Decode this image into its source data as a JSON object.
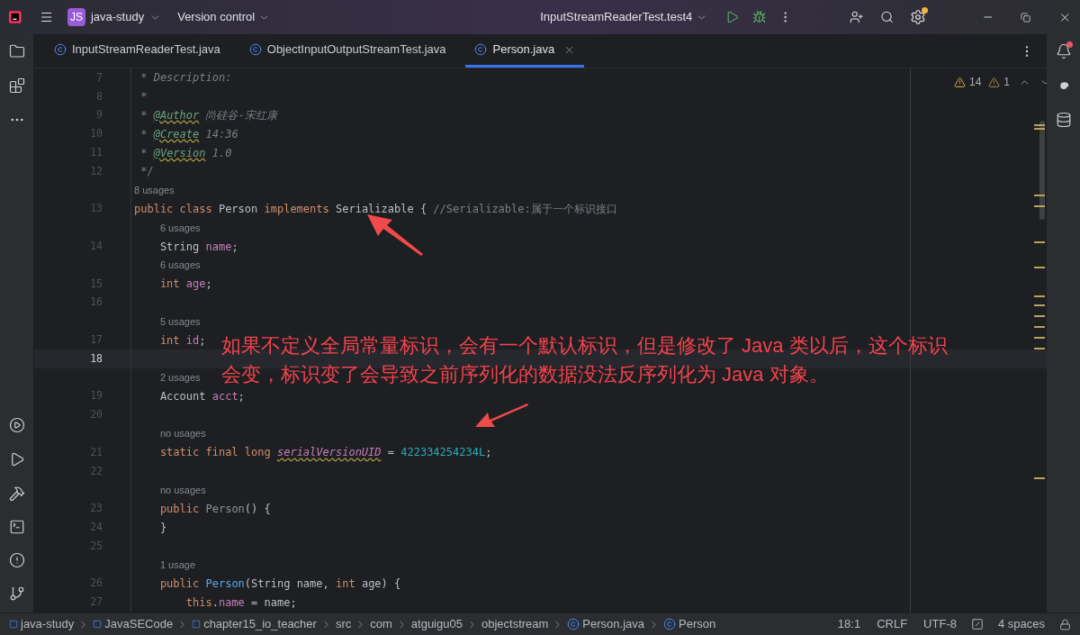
{
  "title_bar": {
    "project": {
      "badge": "JS",
      "name": "java-study"
    },
    "vcs": "Version control",
    "run_config": "InputStreamReaderTest.test4",
    "settings_update": true
  },
  "tabs": [
    {
      "label": "InputStreamReaderTest.java",
      "selected": false,
      "closable": false
    },
    {
      "label": "ObjectInputOutputStreamTest.java",
      "selected": false,
      "closable": false
    },
    {
      "label": "Person.java",
      "selected": true,
      "closable": true
    }
  ],
  "inspections": {
    "warnings": "14",
    "weak_warnings": "1"
  },
  "notifications": {
    "unread": true
  },
  "code": [
    {
      "number": "7",
      "tokens": [
        {
          "text": " * Description:",
          "kind": "doc"
        }
      ]
    },
    {
      "number": "8",
      "tokens": [
        {
          "text": " *",
          "kind": "doc"
        }
      ]
    },
    {
      "number": "9",
      "tokens": [
        {
          "text": " * ",
          "kind": "doc"
        },
        {
          "text": "@Author",
          "kind": "doc-tag"
        },
        {
          "text": " 尚硅谷-宋红康",
          "kind": "doc"
        }
      ]
    },
    {
      "number": "10",
      "tokens": [
        {
          "text": " * ",
          "kind": "doc"
        },
        {
          "text": "@Create",
          "kind": "doc-tag"
        },
        {
          "text": " 14:36",
          "kind": "doc"
        }
      ]
    },
    {
      "number": "11",
      "tokens": [
        {
          "text": " * ",
          "kind": "doc"
        },
        {
          "text": "@Version",
          "kind": "doc-tag"
        },
        {
          "text": " 1.0",
          "kind": "doc"
        }
      ]
    },
    {
      "number": "12",
      "tokens": [
        {
          "text": " */",
          "kind": "doc"
        }
      ]
    },
    {
      "number": "13",
      "usages": "8 usages",
      "tokens": [
        {
          "text": "public class ",
          "kind": "keyword"
        },
        {
          "text": "Person ",
          "kind": "plain"
        },
        {
          "text": "implements ",
          "kind": "keyword"
        },
        {
          "text": "Serializable { ",
          "kind": "plain"
        },
        {
          "text": "//Serializable:属于一个标识接口",
          "kind": "comment"
        }
      ]
    },
    {
      "number": "14",
      "usages": "6 usages",
      "tokens": [
        {
          "text": "    String ",
          "kind": "plain"
        },
        {
          "text": "name",
          "kind": "field"
        },
        {
          "text": ";",
          "kind": "plain"
        }
      ]
    },
    {
      "number": "15",
      "usages": "6 usages",
      "tokens": [
        {
          "text": "    int ",
          "kind": "keyword"
        },
        {
          "text": "age",
          "kind": "field"
        },
        {
          "text": ";",
          "kind": "plain"
        }
      ]
    },
    {
      "number": "16"
    },
    {
      "number": "17",
      "usages": "5 usages",
      "tokens": [
        {
          "text": "    int ",
          "kind": "keyword"
        },
        {
          "text": "id",
          "kind": "field"
        },
        {
          "text": ";",
          "kind": "plain"
        }
      ]
    },
    {
      "number": "18",
      "current": true
    },
    {
      "number": "19",
      "usages": "2 usages",
      "tokens": [
        {
          "text": "    Account ",
          "kind": "plain"
        },
        {
          "text": "acct",
          "kind": "field"
        },
        {
          "text": ";",
          "kind": "plain"
        }
      ]
    },
    {
      "number": "20"
    },
    {
      "number": "21",
      "usages": "no usages",
      "tokens": [
        {
          "text": "    static final long ",
          "kind": "keyword"
        },
        {
          "text": "serialVersionUID",
          "kind": "static-field"
        },
        {
          "text": " = ",
          "kind": "plain"
        },
        {
          "text": "422334254234L",
          "kind": "number"
        },
        {
          "text": ";",
          "kind": "plain"
        }
      ]
    },
    {
      "number": "22"
    },
    {
      "number": "23",
      "usages": "no usages",
      "tokens": [
        {
          "text": "    public ",
          "kind": "keyword"
        },
        {
          "text": "Person",
          "kind": "unused"
        },
        {
          "text": "() {",
          "kind": "plain"
        }
      ]
    },
    {
      "number": "24",
      "tokens": [
        {
          "text": "    }",
          "kind": "plain"
        }
      ]
    },
    {
      "number": "25"
    },
    {
      "number": "26",
      "usages": "1 usage",
      "tokens": [
        {
          "text": "    public ",
          "kind": "keyword"
        },
        {
          "text": "Person",
          "kind": "function"
        },
        {
          "text": "(String name, ",
          "kind": "plain"
        },
        {
          "text": "int ",
          "kind": "keyword"
        },
        {
          "text": "age) {",
          "kind": "plain"
        }
      ]
    },
    {
      "number": "27",
      "tokens": [
        {
          "text": "        this",
          "kind": "keyword"
        },
        {
          "text": ".",
          "kind": "plain"
        },
        {
          "text": "name",
          "kind": "field"
        },
        {
          "text": " = name;",
          "kind": "plain"
        }
      ]
    }
  ],
  "annotation": {
    "lines": [
      "如果不定义全局常量标识，会有一个默认标识，但是修改了 Java 类以后，这个标识",
      "会变，标识变了会导致之前序列化的数据没法反序列化为 Java 对象。"
    ]
  },
  "breadcrumbs": [
    {
      "label": "java-study",
      "kind": "module"
    },
    {
      "label": "JavaSECode",
      "kind": "module"
    },
    {
      "label": "chapter15_io_teacher",
      "kind": "module"
    },
    {
      "label": "src",
      "kind": "folder"
    },
    {
      "label": "com",
      "kind": "folder"
    },
    {
      "label": "atguigu05",
      "kind": "folder"
    },
    {
      "label": "objectstream",
      "kind": "folder"
    },
    {
      "label": "Person.java",
      "kind": "class"
    },
    {
      "label": "Person",
      "kind": "class"
    }
  ],
  "status": {
    "position": "18:1",
    "line_separator": "CRLF",
    "encoding": "UTF-8",
    "indent": "4 spaces"
  }
}
